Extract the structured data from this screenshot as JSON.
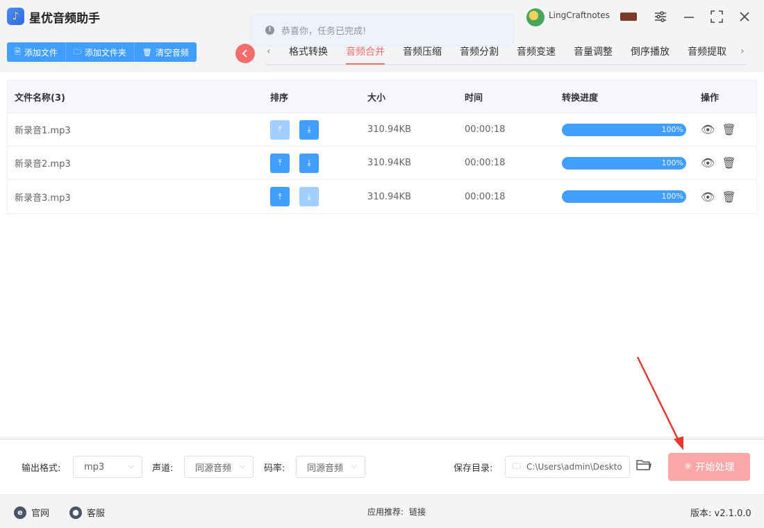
{
  "app": {
    "title": "星优音频助手",
    "username": "LingCraftnotes"
  },
  "toast": {
    "message": "恭喜你，任务已完成!"
  },
  "toolbar": {
    "add_file": "添加文件",
    "add_folder": "添加文件夹",
    "clear": "清空音频"
  },
  "tabs": [
    {
      "label": "格式转换"
    },
    {
      "label": "音频合并",
      "active": true
    },
    {
      "label": "音频压缩"
    },
    {
      "label": "音频分割"
    },
    {
      "label": "音频变速"
    },
    {
      "label": "音量调整"
    },
    {
      "label": "倒序播放"
    },
    {
      "label": "音频提取"
    }
  ],
  "table": {
    "headers": {
      "name": "文件名称(3)",
      "sort": "排序",
      "size": "大小",
      "time": "时间",
      "progress": "转换进度",
      "ops": "操作"
    },
    "rows": [
      {
        "name": "新录音1.mp3",
        "size": "310.94KB",
        "time": "00:00:18",
        "progress": "100%"
      },
      {
        "name": "新录音2.mp3",
        "size": "310.94KB",
        "time": "00:00:18",
        "progress": "100%"
      },
      {
        "name": "新录音3.mp3",
        "size": "310.94KB",
        "time": "00:00:18",
        "progress": "100%"
      }
    ]
  },
  "settings": {
    "format_label": "输出格式:",
    "format_value": "mp3",
    "channel_label": "声道:",
    "channel_value": "同源音频",
    "bitrate_label": "码率:",
    "bitrate_value": "同源音频",
    "dir_label": "保存目录:",
    "dir_value": "C:\\Users\\admin\\Deskto",
    "start_label": "开始处理"
  },
  "footer": {
    "website": "官网",
    "service": "客服",
    "recommend_label": "应用推荐:",
    "recommend_link": "链接",
    "version": "版本:  v2.1.0.0"
  },
  "colors": {
    "primary": "#409eff",
    "accent": "#f56c6c",
    "start_disabled": "#f9a7a7"
  }
}
